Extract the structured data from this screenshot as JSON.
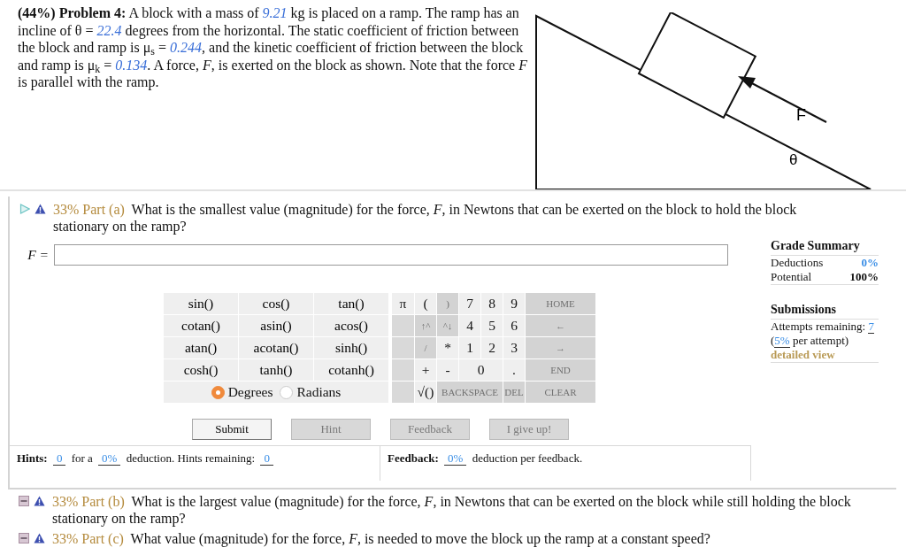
{
  "problem": {
    "segments": [
      {
        "kind": "bold",
        "text": "(44%) Problem 4:"
      },
      {
        "kind": "text",
        "text": " A block with a mass of "
      },
      {
        "kind": "value",
        "text": "9.21"
      },
      {
        "kind": "text",
        "text": " kg is placed on a ramp. The ramp has an incline of θ = "
      },
      {
        "kind": "value",
        "text": "22.4"
      },
      {
        "kind": "text",
        "text": " degrees from the horizontal. The static coefficient of friction between the block and ramp is μ$_{s}$ = "
      },
      {
        "kind": "value",
        "text": "0.244"
      },
      {
        "kind": "text",
        "text": ", and the kinetic coefficient of friction between the block and ramp is μ$_{k}$ = "
      },
      {
        "kind": "value",
        "text": "0.134"
      },
      {
        "kind": "text",
        "text": ". A force, *F*, is exerted on the block as shown. Note that the force *F* is parallel with the ramp."
      }
    ]
  },
  "diagram": {
    "force_label": "F",
    "angle_label": "θ"
  },
  "parts": [
    {
      "percent": "33%",
      "label": "Part (a)",
      "question": "What is the smallest value (magnitude) for the force, *F*, in Newtons that can be exerted on the block to hold the block stationary on the ramp?",
      "expanded": true
    },
    {
      "percent": "33%",
      "label": "Part (b)",
      "question": "What is the largest value (magnitude) for the force, *F*, in Newtons that can be exerted on the block while still holding the block stationary on the ramp?",
      "expanded": false
    },
    {
      "percent": "33%",
      "label": "Part (c)",
      "question": "What value (magnitude) for the force, *F*, is needed to move the block up the ramp at a constant speed?",
      "expanded": false
    }
  ],
  "answer_panel": {
    "input": {
      "label": "F ="
    },
    "functions": [
      "sin()",
      "cos()",
      "tan()",
      "cotan()",
      "asin()",
      "acos()",
      "atan()",
      "acotan()",
      "sinh()",
      "cosh()",
      "tanh()",
      "cotanh()"
    ],
    "angle_modes": [
      {
        "label": "Degrees",
        "selected": true
      },
      {
        "label": "Radians",
        "selected": false
      }
    ],
    "keys": [
      {
        "kind": "key",
        "label": "π",
        "disabled": false
      },
      {
        "kind": "key",
        "label": "(",
        "disabled": false
      },
      {
        "kind": "key",
        "label": ")",
        "disabled": true
      },
      {
        "kind": "key",
        "label": "7",
        "disabled": false
      },
      {
        "kind": "key",
        "label": "8",
        "disabled": false
      },
      {
        "kind": "key",
        "label": "9",
        "disabled": false
      },
      {
        "kind": "key",
        "label": "HOME",
        "disabled": true
      },
      {
        "kind": "blank"
      },
      {
        "kind": "key",
        "label": "↑^",
        "disabled": true
      },
      {
        "kind": "key",
        "label": "^↓",
        "disabled": true
      },
      {
        "kind": "key",
        "label": "4",
        "disabled": false
      },
      {
        "kind": "key",
        "label": "5",
        "disabled": false
      },
      {
        "kind": "key",
        "label": "6",
        "disabled": false
      },
      {
        "kind": "key",
        "label": "←",
        "disabled": true
      },
      {
        "kind": "blank"
      },
      {
        "kind": "key",
        "label": "/",
        "disabled": true
      },
      {
        "kind": "key",
        "label": "*",
        "disabled": false
      },
      {
        "kind": "key",
        "label": "1",
        "disabled": false
      },
      {
        "kind": "key",
        "label": "2",
        "disabled": false
      },
      {
        "kind": "key",
        "label": "3",
        "disabled": false
      },
      {
        "kind": "key",
        "label": "→",
        "disabled": true
      },
      {
        "kind": "blank"
      },
      {
        "kind": "key",
        "label": "+",
        "disabled": false
      },
      {
        "kind": "key",
        "label": "-",
        "disabled": false
      },
      {
        "kind": "double",
        "label": "0",
        "disabled": false
      },
      {
        "kind": "key",
        "label": ".",
        "disabled": false
      },
      {
        "kind": "key",
        "label": "END",
        "disabled": true
      },
      {
        "kind": "blank"
      },
      {
        "kind": "key",
        "label": "√()",
        "disabled": false
      },
      {
        "kind": "triple",
        "label": "BACKSPACE",
        "disabled": true
      },
      {
        "kind": "key",
        "label": "DEL",
        "disabled": true
      },
      {
        "kind": "key",
        "label": "CLEAR",
        "disabled": true
      }
    ],
    "buttons": [
      {
        "label": "Submit",
        "disabled": false
      },
      {
        "label": "Hint",
        "disabled": true
      },
      {
        "label": "Feedback",
        "disabled": true
      },
      {
        "label": "I give up!",
        "disabled": true
      }
    ],
    "hints": [
      {
        "kind": "bold",
        "text": "Hints:"
      },
      {
        "kind": "link",
        "text": "0"
      },
      {
        "kind": "text",
        "text": "for a"
      },
      {
        "kind": "link",
        "text": "0%"
      },
      {
        "kind": "text",
        "text": "deduction. Hints remaining:"
      },
      {
        "kind": "link",
        "text": "0"
      }
    ],
    "feedback": [
      {
        "kind": "bold",
        "text": "Feedback:"
      },
      {
        "kind": "link",
        "text": "0%"
      },
      {
        "kind": "text",
        "text": "deduction per feedback."
      }
    ]
  },
  "grade_summary": {
    "title": "Grade Summary",
    "rows": [
      {
        "label": "Deductions",
        "value": "0%",
        "kind": "link"
      },
      {
        "label": "Potential",
        "value": "100%",
        "kind": "bold"
      }
    ]
  },
  "submissions": {
    "title": "Submissions",
    "segments": [
      {
        "kind": "text",
        "text": "Attempts remaining: "
      },
      {
        "kind": "link",
        "text": "7"
      },
      {
        "kind": "text",
        "text": " ("
      },
      {
        "kind": "link",
        "text": "5%"
      },
      {
        "kind": "text",
        "text": " per attempt)"
      }
    ],
    "detail_link": "detailed view"
  }
}
